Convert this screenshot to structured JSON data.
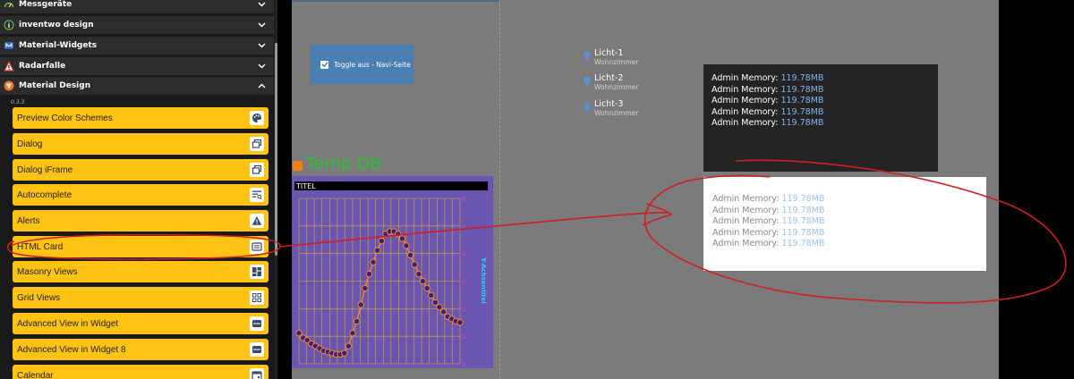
{
  "sidebar": {
    "categories": [
      {
        "label": "Messgeräte",
        "icon": "gauge-icon"
      },
      {
        "label": "inventwo design",
        "icon": "inventwo-logo-icon"
      },
      {
        "label": "Material-Widgets",
        "icon": "material-widgets-icon"
      },
      {
        "label": "Radarfalle",
        "icon": "warning-icon"
      },
      {
        "label": "Material Design",
        "icon": "material-design-logo-icon"
      }
    ],
    "version": "0.3.3",
    "items": [
      {
        "label": "Preview Color Schemes",
        "icon": "palette-icon"
      },
      {
        "label": "Dialog",
        "icon": "dialog-icon"
      },
      {
        "label": "Dialog iFrame",
        "icon": "dialog-iframe-icon"
      },
      {
        "label": "Autocomplete",
        "icon": "autocomplete-icon"
      },
      {
        "label": "Alerts",
        "icon": "alert-icon"
      },
      {
        "label": "HTML Card",
        "icon": "card-icon"
      },
      {
        "label": "Masonry Views",
        "icon": "masonry-icon"
      },
      {
        "label": "Grid Views",
        "icon": "grid-icon"
      },
      {
        "label": "Advanced View in Widget",
        "icon": "view-icon"
      },
      {
        "label": "Advanced View in Widget 8",
        "icon": "view-icon"
      },
      {
        "label": "Calendar",
        "icon": "calendar-icon"
      }
    ]
  },
  "toggle": {
    "label": "Toggle aus - Navi-Seite",
    "checked": true
  },
  "lights": [
    {
      "name": "Licht-1",
      "room": "Wohnzimmer"
    },
    {
      "name": "Licht-2",
      "room": "Wohnzimmer"
    },
    {
      "name": "Licht-3",
      "room": "Wohnzimmer"
    }
  ],
  "temp_widget": {
    "label": "Temp DB"
  },
  "chart_data": {
    "type": "line",
    "title": "TITEL",
    "ylabel": "Y-Achsentitel",
    "xlabel": "",
    "ylim": [
      0,
      7
    ],
    "yticks": [
      "0",
      "0",
      "0",
      "0",
      "0",
      "0",
      "0"
    ],
    "series": [
      {
        "values": [
          1.3,
          1.1,
          1.0,
          0.85,
          0.75,
          0.65,
          0.55,
          0.5,
          0.45,
          0.4,
          0.4,
          0.45,
          0.75,
          1.3,
          1.8,
          2.5,
          3.2,
          3.8,
          4.3,
          4.8,
          5.2,
          5.5,
          5.6,
          5.6,
          5.5,
          5.3,
          5.0,
          4.6,
          4.2,
          3.8,
          3.5,
          3.2,
          2.9,
          2.6,
          2.4,
          2.2,
          2.0,
          1.9,
          1.8,
          1.75
        ]
      }
    ],
    "grid": true,
    "colors": {
      "background": "#6a55b0",
      "line": "#f58a1f",
      "marker": "#3a1f85",
      "grid": "#d9a92c",
      "ytick": "#e23de0",
      "ylabel": "#2fd0e6"
    }
  },
  "cards": [
    {
      "rows": [
        {
          "key": "Admin Memory:",
          "value": "119.78MB"
        },
        {
          "key": "Admin Memory:",
          "value": "119.78MB"
        },
        {
          "key": "Admin Memory:",
          "value": "119.78MB"
        },
        {
          "key": "Admin Memory:",
          "value": "119.78MB"
        },
        {
          "key": "Admin Memory:",
          "value": "119.78MB"
        }
      ]
    },
    {
      "rows": [
        {
          "key": "Admin Memory:",
          "value": "119.78MB"
        },
        {
          "key": "Admin Memory:",
          "value": "119.78MB"
        },
        {
          "key": "Admin Memory:",
          "value": "119.78MB"
        },
        {
          "key": "Admin Memory:",
          "value": "119.78MB"
        },
        {
          "key": "Admin Memory:",
          "value": "119.78MB"
        }
      ]
    }
  ],
  "colors": {
    "accent": "#fec313",
    "annotation": "#d01f1f",
    "toggle": "#4a7fb3"
  }
}
